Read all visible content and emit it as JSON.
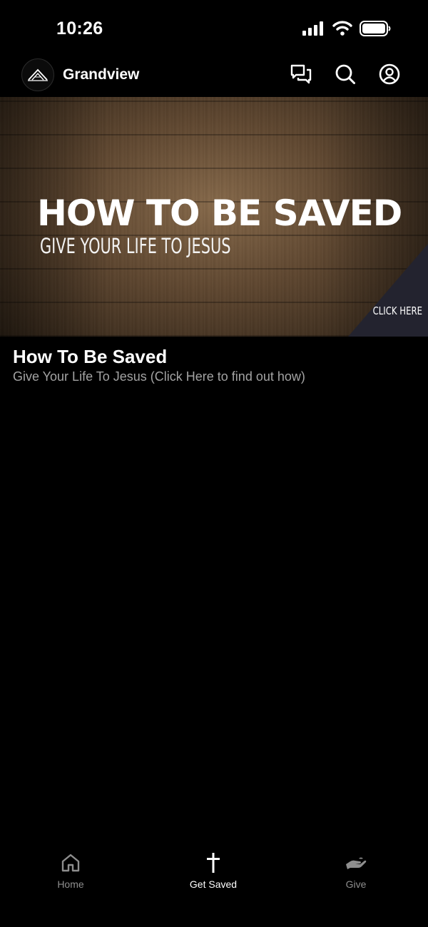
{
  "status_bar": {
    "time": "10:26",
    "icons": [
      "cellular-signal-icon",
      "wifi-icon",
      "battery-icon"
    ]
  },
  "header": {
    "title": "Grandview",
    "logo_icon": "mountain-logo-icon",
    "actions": [
      "chat-icon",
      "search-icon",
      "profile-icon"
    ]
  },
  "banner": {
    "heading": "HOW TO BE SAVED",
    "subheading": "GIVE YOUR LIFE TO JESUS",
    "cta": "CLICK HERE"
  },
  "content": {
    "title": "How To Be Saved",
    "subtitle": "Give Your Life To Jesus (Click Here to find out how)"
  },
  "tabs": [
    {
      "label": "Home",
      "icon": "home-icon",
      "active": false
    },
    {
      "label": "Get Saved",
      "icon": "cross-icon",
      "active": true
    },
    {
      "label": "Give",
      "icon": "giving-hand-icon",
      "active": false
    }
  ],
  "colors": {
    "background": "#000000",
    "text_primary": "#ffffff",
    "text_secondary": "#a3a3a3",
    "tab_inactive": "#8e8e8e",
    "banner_corner": "#23232f"
  }
}
